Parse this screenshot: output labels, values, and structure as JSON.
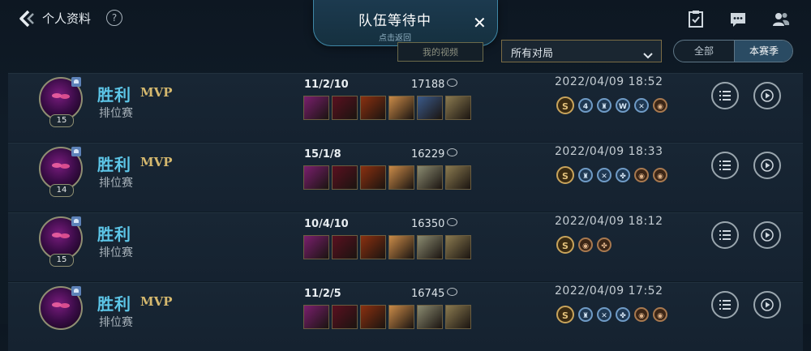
{
  "header": {
    "title": "个人资料",
    "help_label": "?"
  },
  "queue_popup": {
    "title": "队伍等待中",
    "subtitle": "点击返回",
    "close_label": "✕"
  },
  "filters": {
    "video_button_label": "我的视频",
    "match_select_value": "所有对局",
    "segment": {
      "all_label": "全部",
      "season_label": "本赛季",
      "selected": "本赛季"
    }
  },
  "matches": [
    {
      "result": "胜利",
      "mvp": "MVP",
      "mode": "排位赛",
      "level": "15",
      "kda": "11/2/10",
      "gold": "17188",
      "date": "2022/04/09 18:52",
      "items": [
        "#7a1f6e",
        "#5a1020",
        "#8a3010",
        "#c98a48",
        "#3b5a8a",
        "#8a7a50"
      ],
      "badges": [
        {
          "type": "gold",
          "symbol": "S"
        },
        {
          "type": "blue",
          "symbol": "4"
        },
        {
          "type": "blue",
          "symbol": "♜"
        },
        {
          "type": "blue",
          "symbol": "W"
        },
        {
          "type": "blue",
          "symbol": "✕"
        },
        {
          "type": "bronze",
          "symbol": "◉"
        }
      ]
    },
    {
      "result": "胜利",
      "mvp": "MVP",
      "mode": "排位赛",
      "level": "14",
      "kda": "15/1/8",
      "gold": "16229",
      "date": "2022/04/09 18:33",
      "items": [
        "#7a1f6e",
        "#5a1020",
        "#8a3010",
        "#c98a48",
        "#8a8a70",
        "#8a7a50"
      ],
      "badges": [
        {
          "type": "gold",
          "symbol": "S"
        },
        {
          "type": "blue",
          "symbol": "♜"
        },
        {
          "type": "blue",
          "symbol": "✕"
        },
        {
          "type": "blue",
          "symbol": "✤"
        },
        {
          "type": "bronze",
          "symbol": "◉"
        },
        {
          "type": "bronze",
          "symbol": "◉"
        }
      ]
    },
    {
      "result": "胜利",
      "mvp": "",
      "mode": "排位赛",
      "level": "15",
      "kda": "10/4/10",
      "gold": "16350",
      "date": "2022/04/09 18:12",
      "items": [
        "#7a1f6e",
        "#5a1020",
        "#8a3010",
        "#c98a48",
        "#8a8a70",
        "#8a7a50"
      ],
      "badges": [
        {
          "type": "gold",
          "symbol": "S"
        },
        {
          "type": "bronze",
          "symbol": "◉"
        },
        {
          "type": "bronze",
          "symbol": "✤"
        }
      ]
    },
    {
      "result": "胜利",
      "mvp": "MVP",
      "mode": "排位赛",
      "level": "",
      "kda": "11/2/5",
      "gold": "16745",
      "date": "2022/04/09 17:52",
      "items": [
        "#7a1f6e",
        "#5a1020",
        "#8a3010",
        "#c98a48",
        "#8a8a70",
        "#8a7a50"
      ],
      "badges": [
        {
          "type": "gold",
          "symbol": "S"
        },
        {
          "type": "blue",
          "symbol": "♜"
        },
        {
          "type": "blue",
          "symbol": "✕"
        },
        {
          "type": "blue",
          "symbol": "✤"
        },
        {
          "type": "bronze",
          "symbol": "◉"
        },
        {
          "type": "bronze",
          "symbol": "◉"
        }
      ]
    }
  ]
}
